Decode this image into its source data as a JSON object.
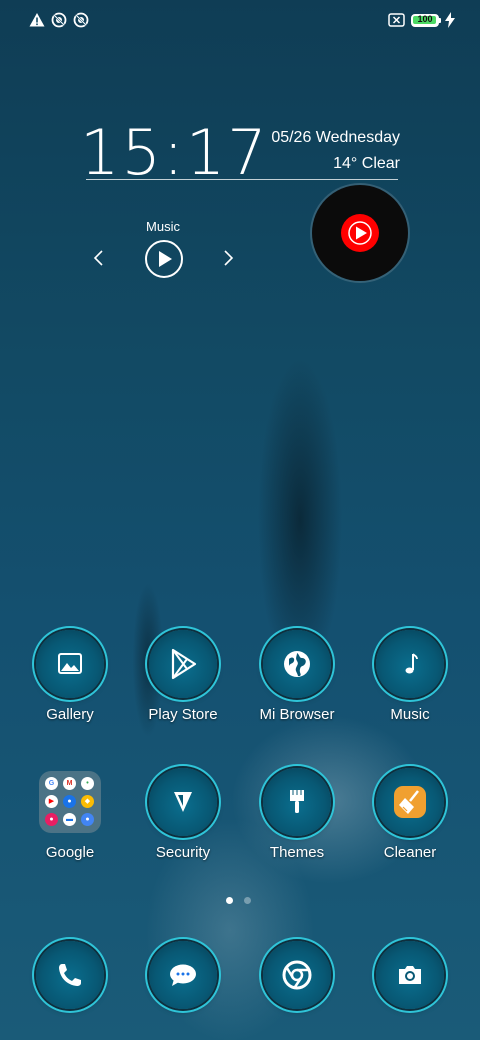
{
  "status_bar": {
    "icons": [
      "warning-icon",
      "no-disturb-icon",
      "no-disturb-icon"
    ],
    "battery_level": "100",
    "battery_fraction": 1.0,
    "right_icons": [
      "sim-off-icon",
      "battery-icon",
      "charging-icon"
    ]
  },
  "clock": {
    "time": "15:17",
    "date": "05/26  Wednesday",
    "weather": "14° Clear"
  },
  "music_widget": {
    "title": "Music"
  },
  "apps": {
    "gallery": "Gallery",
    "play_store": "Play Store",
    "mi_browser": "Mi Browser",
    "music": "Music",
    "google": "Google",
    "security": "Security",
    "themes": "Themes",
    "cleaner": "Cleaner"
  },
  "google_folder": [
    "G",
    "M",
    "•",
    "▶",
    "●",
    "◆",
    "●",
    "▬",
    "●"
  ],
  "page_indicator": {
    "pages": 2,
    "current": 1
  },
  "dock": [
    "phone-icon",
    "messages-icon",
    "chrome-icon",
    "camera-icon"
  ],
  "colors": {
    "accent_ring": "#2fc4d8",
    "youtube_red": "#ff0000",
    "battery_green": "#4cd964"
  }
}
